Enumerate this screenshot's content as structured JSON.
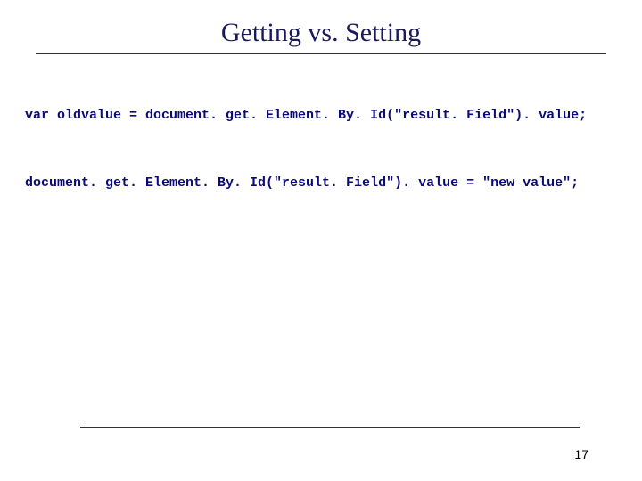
{
  "slide": {
    "title": "Getting vs. Setting",
    "code_line_1": "var oldvalue = document. get. Element. By. Id(\"result. Field\"). value;",
    "code_line_2": "document. get. Element. By. Id(\"result. Field\"). value = \"new value\";",
    "page_number": "17"
  }
}
